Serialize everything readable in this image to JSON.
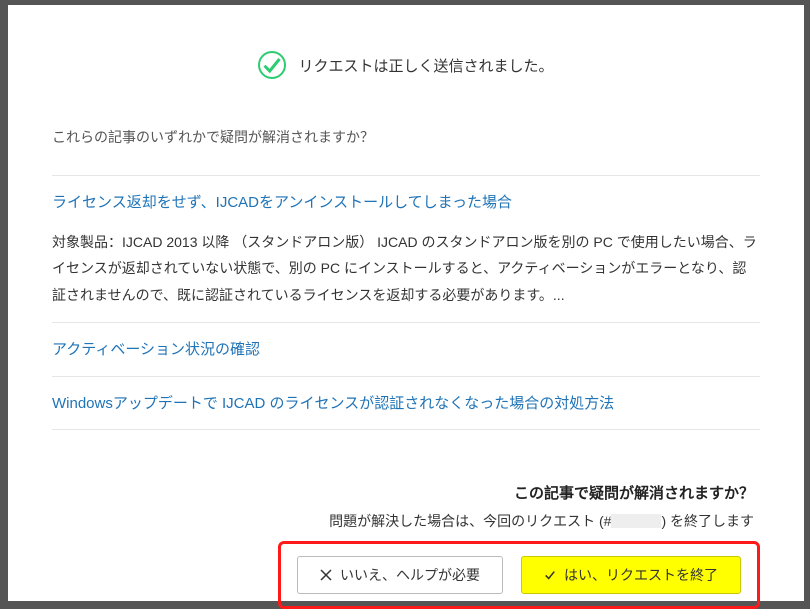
{
  "success": {
    "message": "リクエストは正しく送信されました。"
  },
  "prompt": "これらの記事のいずれかで疑問が解消されますか？",
  "articles": [
    {
      "title": "ライセンス返却をせず、IJCADをアンインストールしてしまった場合",
      "body": "対象製品：IJCAD 2013 以降 （スタンドアロン版） IJCAD のスタンドアロン版を別の PC で使用したい場合、ライセンスが返却されていない状態で、別の PC にインストールすると、アクティベーションがエラーとなり、認証されませんので、既に認証されているライセンスを返却する必要があります。..."
    },
    {
      "title": "アクティベーション状況の確認"
    },
    {
      "title": "Windowsアップデートで IJCAD のライセンスが認証されなくなった場合の対処方法"
    }
  ],
  "confirm": {
    "question": "この記事で疑問が解消されますか？",
    "sub_pre": "問題が解決した場合は、今回のリクエスト (#",
    "sub_post": ") を終了します",
    "no_label": "いいえ、ヘルプが必要",
    "yes_label": "はい、リクエストを終了"
  }
}
